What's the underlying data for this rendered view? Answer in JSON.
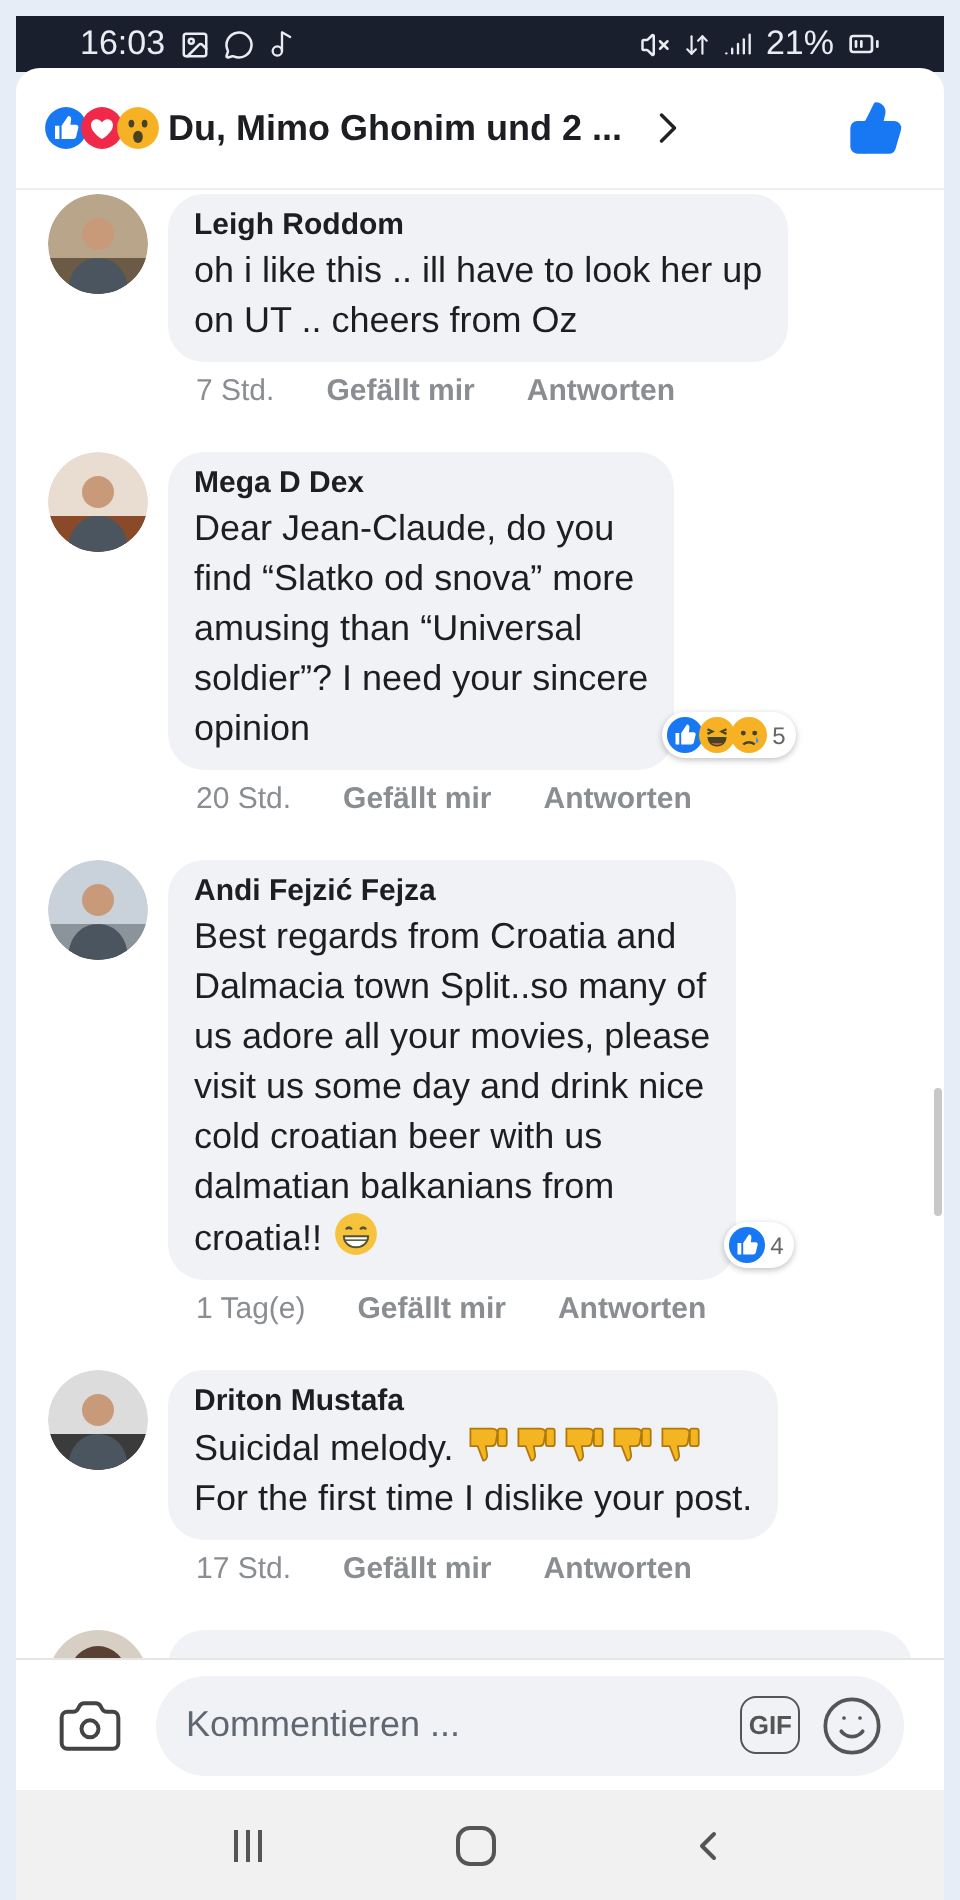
{
  "status_bar": {
    "time": "16:03",
    "battery": "21%"
  },
  "header": {
    "reactions": [
      {
        "kind": "like"
      },
      {
        "kind": "love"
      },
      {
        "kind": "wow"
      }
    ],
    "title": "Du, Mimo Ghonim und 2 ..."
  },
  "comments": [
    {
      "author": "Leigh Roddom",
      "lines": [
        {
          "text": "oh i like this .. ill have to look her up"
        },
        {
          "text": "on UT .. cheers from Oz"
        }
      ],
      "time": "7 Std.",
      "like": "Gefällt mir",
      "reply": "Antworten"
    },
    {
      "author": "Mega D Dex",
      "lines": [
        {
          "text": "Dear Jean-Claude, do you"
        },
        {
          "text": "find “Slatko od snova” more"
        },
        {
          "text": "amusing than “Universal"
        },
        {
          "text": "soldier”? I need your sincere"
        },
        {
          "text": "opinion"
        }
      ],
      "reactions": {
        "items": [
          {
            "kind": "like"
          },
          {
            "kind": "haha"
          },
          {
            "kind": "sad"
          }
        ],
        "count": "5"
      },
      "time": "20 Std.",
      "like": "Gefällt mir",
      "reply": "Antworten"
    },
    {
      "author": "Andi Fejzić Fejza",
      "lines": [
        {
          "text": "Best regards from Croatia and"
        },
        {
          "text": "Dalmacia town Split..so many of"
        },
        {
          "text": "us adore all your movies, please"
        },
        {
          "text": "visit us some day and drink nice"
        },
        {
          "text": "cold croatian beer with us"
        },
        {
          "text": "dalmatian balkanians from"
        },
        {
          "text": "croatia!!",
          "emoji": [
            {
              "kind": "grin"
            }
          ]
        }
      ],
      "reactions": {
        "items": [
          {
            "kind": "like"
          }
        ],
        "count": "4"
      },
      "time": "1 Tag(e)",
      "like": "Gefällt mir",
      "reply": "Antworten"
    },
    {
      "author": "Driton Mustafa",
      "lines": [
        {
          "text": "Suicidal melody.",
          "emoji": [
            {
              "kind": "thumbs_down"
            },
            {
              "kind": "thumbs_down"
            },
            {
              "kind": "thumbs_down"
            },
            {
              "kind": "thumbs_down"
            },
            {
              "kind": "thumbs_down"
            }
          ]
        },
        {
          "text": "For the first time I dislike your post."
        }
      ],
      "time": "17 Std.",
      "like": "Gefällt mir",
      "reply": "Antworten"
    }
  ],
  "composer": {
    "placeholder": "Kommentieren ...",
    "gif": "GIF"
  }
}
